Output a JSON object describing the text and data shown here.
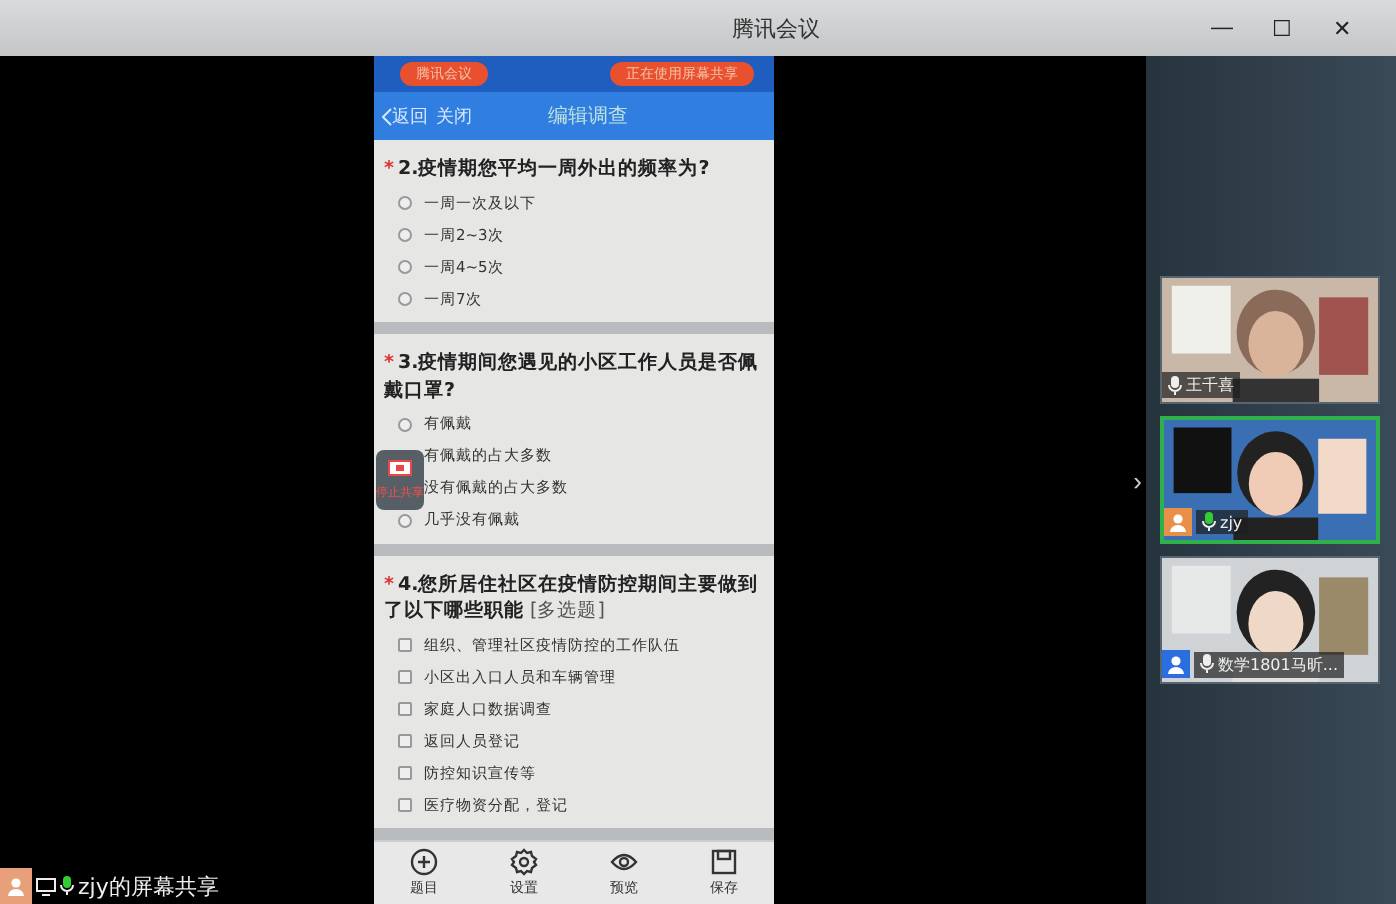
{
  "window": {
    "title": "腾讯会议",
    "controls": [
      "—",
      "☐",
      "✕"
    ]
  },
  "phone": {
    "top_pills": [
      "腾讯会议",
      "正在使用屏幕共享"
    ],
    "nav": {
      "back": "返回",
      "close": "关闭",
      "title": "编辑调查"
    },
    "questions": [
      {
        "kind": "radio",
        "required_mark": "*",
        "title": "2.疫情期您平均一周外出的频率为?",
        "options": [
          {
            "label": "一周一次及以下",
            "checked": false
          },
          {
            "label": "一周2~3次",
            "checked": false
          },
          {
            "label": "一周4~5次",
            "checked": false
          },
          {
            "label": "一周7次",
            "checked": false
          }
        ]
      },
      {
        "kind": "radio",
        "required_mark": "*",
        "title": "3.疫情期间您遇见的小区工作人员是否佩戴口罩?",
        "options": [
          {
            "label": "有佩戴",
            "checked": false
          },
          {
            "label": "有佩戴的占大多数",
            "covered": true
          },
          {
            "label": "没有佩戴的占大多数",
            "covered": true
          },
          {
            "label": "几乎没有佩戴",
            "checked": false
          }
        ]
      },
      {
        "kind": "checkbox",
        "required_mark": "*",
        "title": "4.您所居住社区在疫情防控期间主要做到了以下哪些职能",
        "tag": "[多选题]",
        "options": [
          {
            "label": "组织、管理社区疫情防控的工作队伍",
            "checked": false
          },
          {
            "label": "小区出入口人员和车辆管理",
            "checked": false
          },
          {
            "label": "家庭人口数据调查",
            "checked": false
          },
          {
            "label": "返回人员登记",
            "checked": false
          },
          {
            "label": "防控知识宣传等",
            "checked": false
          },
          {
            "label": "医疗物资分配，登记",
            "checked": false
          }
        ]
      }
    ],
    "tabbar": [
      "题目",
      "设置",
      "预览",
      "保存"
    ]
  },
  "stop_share": {
    "label": "停止共享"
  },
  "participants": [
    {
      "name": "王千喜",
      "speaking": false,
      "selected": false,
      "avatar": false
    },
    {
      "name": "zjy",
      "speaking": true,
      "selected": true,
      "avatar": true
    },
    {
      "name": "数学1801马昕...",
      "speaking": false,
      "selected": false,
      "avatar": true
    }
  ],
  "sidebar_toggle": "›",
  "share_label": {
    "text": "zjy的屏幕共享",
    "speaking": true
  }
}
